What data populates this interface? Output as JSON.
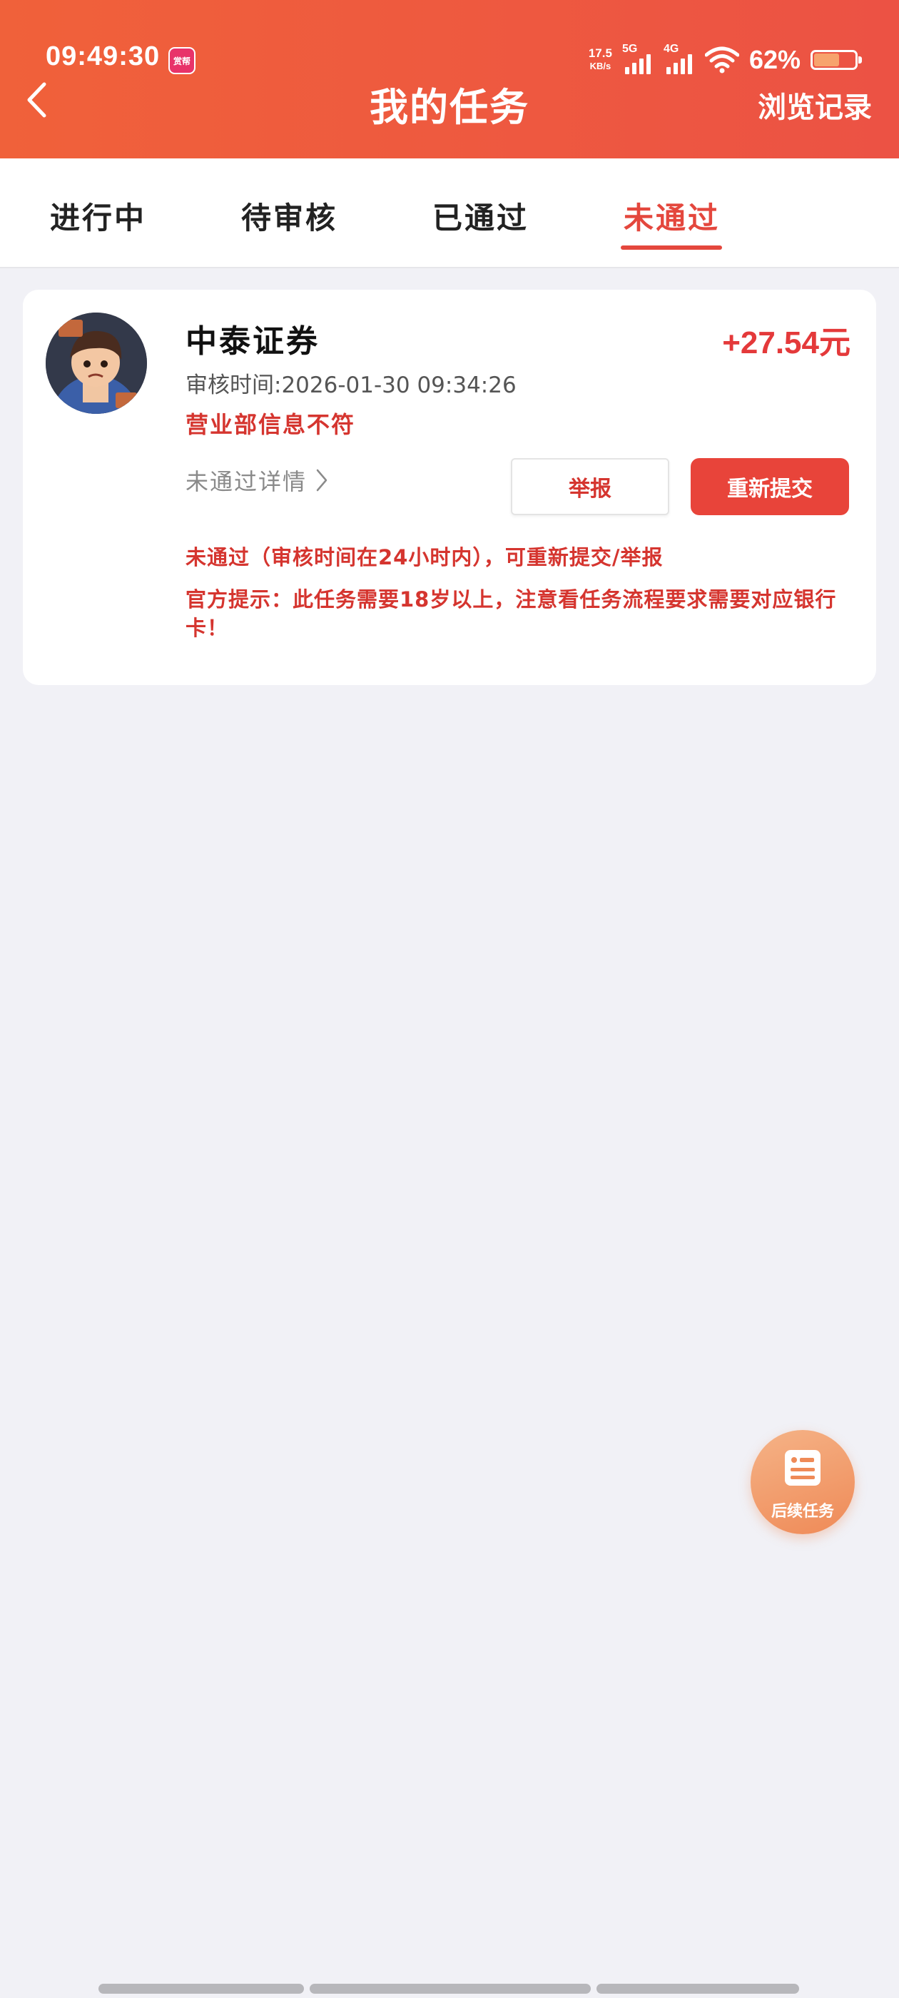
{
  "status_bar": {
    "time": "09:49:30",
    "app_badge": "赏帮",
    "net_speed_value": "17.5",
    "net_speed_unit": "KB/s",
    "sim1": "5G",
    "sim2": "4G",
    "battery_percent": "62%",
    "battery_level": 0.62
  },
  "header": {
    "title": "我的任务",
    "history_label": "浏览记录"
  },
  "tabs": [
    {
      "label": "进行中",
      "active": false
    },
    {
      "label": "待审核",
      "active": false
    },
    {
      "label": "已通过",
      "active": false
    },
    {
      "label": "未通过",
      "active": true
    }
  ],
  "task": {
    "name": "中泰证券",
    "reward": "+27.54元",
    "review_time": "审核时间:2026-01-30 09:34:26",
    "reason": "营业部信息不符",
    "detail_link": "未通过详情",
    "report_button": "举报",
    "resubmit_button": "重新提交",
    "note_status": "未通过（审核时间在24小时内），可重新提交/举报",
    "note_official": "官方提示：此任务需要18岁以上，注意看任务流程要求需要对应银行卡！"
  },
  "floating_button": {
    "label": "后续任务"
  },
  "colors": {
    "brand": "#ec5244",
    "accent_red": "#e4393a",
    "float_orange": "#ef8a57"
  }
}
